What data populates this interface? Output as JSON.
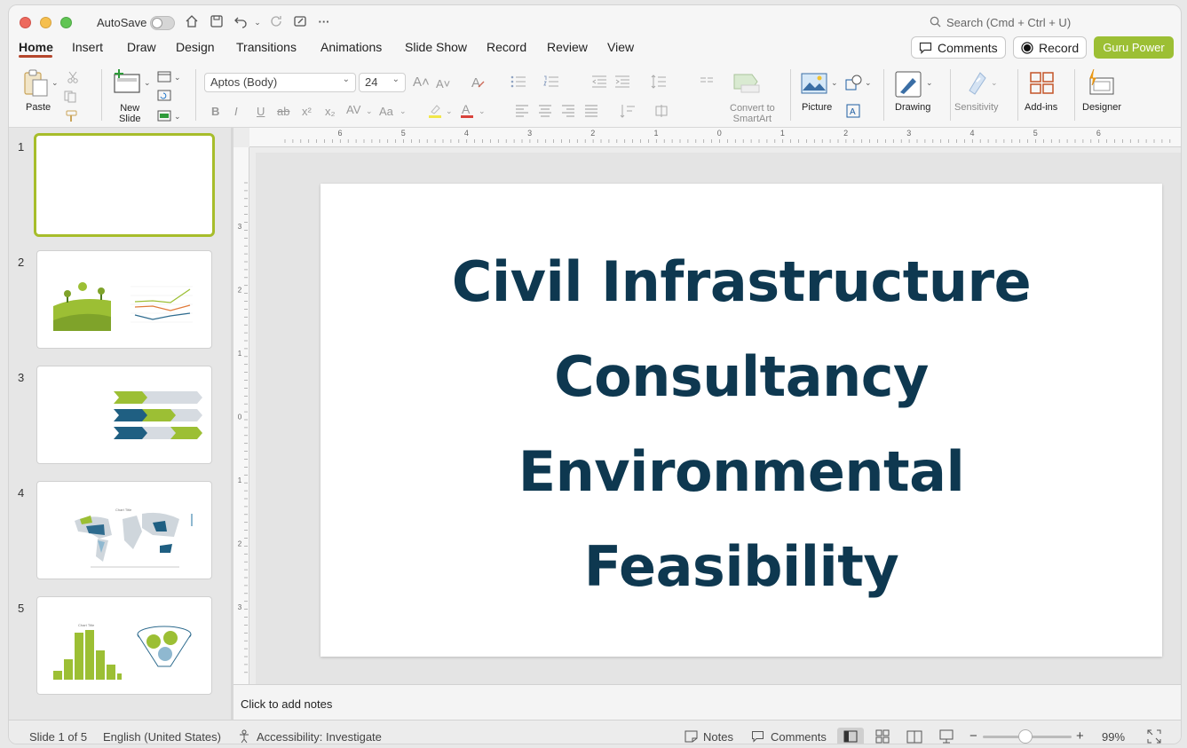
{
  "titlebar": {
    "autosave_label": "AutoSave",
    "search_placeholder": "Search (Cmd + Ctrl + U)",
    "more_glyph": "···"
  },
  "tabs": [
    {
      "label": "Home",
      "active": true
    },
    {
      "label": "Insert"
    },
    {
      "label": "Draw"
    },
    {
      "label": "Design"
    },
    {
      "label": "Transitions"
    },
    {
      "label": "Animations"
    },
    {
      "label": "Slide Show"
    },
    {
      "label": "Record"
    },
    {
      "label": "Review"
    },
    {
      "label": "View"
    }
  ],
  "header_buttons": {
    "comments": "Comments",
    "record": "Record",
    "guru": "Guru Power"
  },
  "ribbon": {
    "paste": "Paste",
    "new_slide_line1": "New",
    "new_slide_line2": "Slide",
    "font_name": "Aptos (Body)",
    "font_size": "24",
    "convert_line1": "Convert to",
    "convert_line2": "SmartArt",
    "picture": "Picture",
    "drawing": "Drawing",
    "sensitivity": "Sensitivity",
    "addins": "Add-ins",
    "designer": "Designer",
    "bold": "B",
    "italic": "I",
    "underline": "U",
    "strike": "ab",
    "superscript": "x²",
    "subscript": "x₂",
    "char_spacing": "AV",
    "change_case": "Aa",
    "grow_font": "A˄",
    "shrink_font": "A˅",
    "font_color_glyph": "A"
  },
  "thumbnails": [
    {
      "num": "1",
      "selected": true
    },
    {
      "num": "2"
    },
    {
      "num": "3"
    },
    {
      "num": "4",
      "chart_title": "Chart Title"
    },
    {
      "num": "5",
      "chart_title": "Chart Title"
    }
  ],
  "ruler": {
    "h_ticks": [
      "6",
      "5",
      "4",
      "3",
      "2",
      "1",
      "0",
      "1",
      "2",
      "3",
      "4",
      "5",
      "6"
    ],
    "v_ticks": [
      "3",
      "2",
      "1",
      "0",
      "1",
      "2",
      "3"
    ]
  },
  "slide": {
    "title_lines": [
      "Civil Infrastructure",
      "Consultancy",
      "Environmental",
      "Feasibility"
    ],
    "title_color": "#0e3850"
  },
  "notes_placeholder": "Click to add notes",
  "status": {
    "slide_info": "Slide 1 of 5",
    "language": "English (United States)",
    "accessibility": "Accessibility: Investigate",
    "notes": "Notes",
    "comments": "Comments",
    "zoom": "99%",
    "zoom_minus": "−",
    "zoom_plus": "+"
  },
  "colors": {
    "accent_green": "#9cbf34",
    "thumb_selected_border": "#a7bd2b",
    "tab_underline": "#b5462c"
  }
}
